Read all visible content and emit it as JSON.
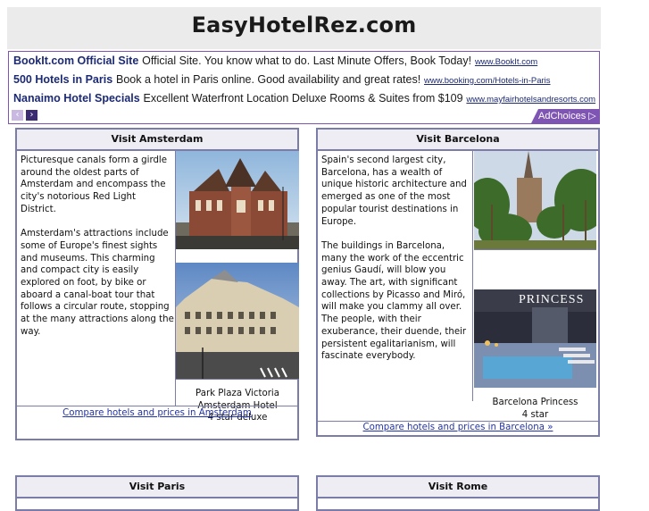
{
  "site": {
    "title": "EasyHotelRez.com"
  },
  "ads": {
    "items": [
      {
        "title": "BookIt.com Official Site",
        "description": "Official Site. You know what to do. Last Minute Offers, Book Today!",
        "url": "www.BookIt.com"
      },
      {
        "title": "500 Hotels in Paris",
        "description": "Book a hotel in Paris online. Good availability and great rates!",
        "url": "www.booking.com/Hotels-in-Paris"
      },
      {
        "title": "Nanaimo Hotel Specials",
        "description": "Excellent Waterfront Location Deluxe Rooms & Suites from $109",
        "url": "www.mayfairhotelsandresorts.com"
      }
    ],
    "prev_icon": "‹",
    "next_icon": "›",
    "adchoices_label": "AdChoices ▷"
  },
  "cards": {
    "amsterdam": {
      "title": "Visit Amsterdam",
      "paragraphs": [
        "Picturesque canals form a girdle around the oldest parts of Amsterdam and encompass the city's notorious Red Light District.",
        "Amsterdam's attractions include some of Europe's finest sights and museums. This charming and compact city is easily explored on foot, by bike or aboard a canal-boat tour that follows a circular route, stopping at the many attractions along the way."
      ],
      "hotel_name": "Park Plaza Victoria Amsterdam Hotel",
      "hotel_rating": "4 star deluxe",
      "compare_link": "Compare hotels and prices in Amsterdam"
    },
    "barcelona": {
      "title": "Visit Barcelona",
      "paragraphs": [
        "Spain's second largest city, Barcelona, has a wealth of unique historic architecture and emerged as one of the most popular tourist destinations in Europe.",
        "The buildings in Barcelona, many the work of the eccentric genius Gaudí, will blow you away. The art, with significant collections by Picasso and Miró, will make you clammy all over. The people, with their exuberance, their duende, their persistent egalitarianism, will fascinate everybody."
      ],
      "sign_text": "PRINCESS",
      "hotel_name": "Barcelona Princess",
      "hotel_rating": "4 star",
      "compare_link": "Compare hotels and prices in Barcelona »"
    },
    "paris": {
      "title": "Visit Paris"
    },
    "rome": {
      "title": "Visit Rome"
    }
  }
}
